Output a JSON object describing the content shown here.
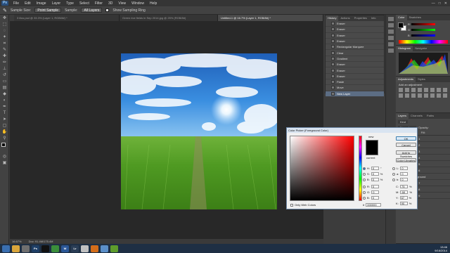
{
  "menubar": {
    "logo": "Ps",
    "items": [
      "File",
      "Edit",
      "Image",
      "Layer",
      "Type",
      "Select",
      "Filter",
      "3D",
      "View",
      "Window",
      "Help"
    ],
    "window_controls": [
      "—",
      "□",
      "✕"
    ]
  },
  "options_bar": {
    "sample_size_label": "Sample Size:",
    "sample_size_value": "Point Sample",
    "sample_label": "Sample:",
    "sample_value": "All Layers",
    "show_ring_label": "Show Sampling Ring"
  },
  "doc_tabs": [
    {
      "label": "3 illus.psd @ 33.3% (Layer 1, RGB/8#) *",
      "active": false
    },
    {
      "label": "Green rice fields in Sep 2014.jpg @ 25% (RGB/8#)",
      "active": false
    },
    {
      "label": "Untitled-1 @ 16.7% (Layer 1, RGB/8#) *",
      "active": true
    }
  ],
  "status_bar": {
    "zoom": "16.67%",
    "doc_size": "Doc: 91.4M/175.4M"
  },
  "history_panel": {
    "tabs": [
      "History",
      "Actions",
      "Properties",
      "Info"
    ],
    "items": [
      "Eraser",
      "Eraser",
      "Eraser",
      "Eraser",
      "Rectangular Marquee",
      "Clear",
      "Gradient",
      "Eraser",
      "Eraser",
      "Eraser",
      "Paste",
      "Move",
      "New Layer"
    ],
    "selected_index": 12
  },
  "color_panel": {
    "tabs": [
      "Color",
      "Swatches"
    ],
    "slider_labels": [
      "R",
      "G",
      "B"
    ],
    "fg_color": "#000000",
    "bg_color": "#ffffff"
  },
  "histogram_panel": {
    "tabs": [
      "Histogram",
      "Navigator"
    ]
  },
  "adjustments_panel": {
    "tabs": [
      "Adjustments",
      "Styles"
    ],
    "add_label": "Add an adjustment"
  },
  "layers_panel": {
    "tabs": [
      "Layers",
      "Channels",
      "Paths"
    ],
    "kind_label": "Kind",
    "blend_mode": "Normal",
    "opacity_label": "Opacity:",
    "lock_label": "Lock:",
    "fill_label": "Fill:",
    "layers": [
      "Layer 1",
      "Layer 2",
      "Layer 3",
      "Layer 4",
      "Layer 5",
      "Layer 6",
      "Background",
      "Layer 7",
      "Layer 8",
      "Layer 9"
    ]
  },
  "color_picker": {
    "title": "Color Picker (Foreground Color)",
    "ok": "OK",
    "cancel": "Cancel",
    "add_to_swatches": "Add to Swatches",
    "color_libraries": "Color Libraries",
    "new_label": "new",
    "current_label": "current",
    "only_web_colors": "Only Web Colors",
    "hsb": [
      {
        "label": "H:",
        "value": "0",
        "unit": "°"
      },
      {
        "label": "S:",
        "value": "0",
        "unit": "%"
      },
      {
        "label": "B:",
        "value": "0",
        "unit": "%"
      }
    ],
    "rgb": [
      {
        "label": "R:",
        "value": "0"
      },
      {
        "label": "G:",
        "value": "0"
      },
      {
        "label": "B:",
        "value": "0"
      }
    ],
    "lab": [
      {
        "label": "L:",
        "value": "0"
      },
      {
        "label": "a:",
        "value": "0"
      },
      {
        "label": "b:",
        "value": "0"
      }
    ],
    "cmyk": [
      {
        "label": "C:",
        "value": "75",
        "unit": "%"
      },
      {
        "label": "M:",
        "value": "68",
        "unit": "%"
      },
      {
        "label": "Y:",
        "value": "67",
        "unit": "%"
      },
      {
        "label": "K:",
        "value": "90",
        "unit": "%"
      }
    ],
    "hex_label": "#",
    "hex_value": "000000"
  },
  "taskbar": {
    "apps": [
      {
        "icon": "start-orb",
        "label": "",
        "color": "#3a6fb0"
      },
      {
        "icon": "explorer",
        "label": "",
        "color": "#d9a53b"
      },
      {
        "icon": "media",
        "label": "",
        "color": "#6f6f6f"
      },
      {
        "icon": "photoshop",
        "label": "Ps",
        "color": "#1f3f66"
      },
      {
        "icon": "nero",
        "label": "",
        "color": "#111111"
      },
      {
        "icon": "chrome",
        "label": "",
        "color": "#3b8e3b"
      },
      {
        "icon": "word",
        "label": "W",
        "color": "#2b5797"
      },
      {
        "icon": "lightroom",
        "label": "Lr",
        "color": "#2a3d55"
      },
      {
        "icon": "paint",
        "label": "",
        "color": "#c0c0c0"
      },
      {
        "icon": "media-player",
        "label": "",
        "color": "#d46d1a"
      },
      {
        "icon": "screen",
        "label": "",
        "color": "#5b8fc9"
      },
      {
        "icon": "nvidia",
        "label": "",
        "color": "#5e9c2c"
      }
    ],
    "time": "13:46",
    "date": "9/16/2014"
  }
}
